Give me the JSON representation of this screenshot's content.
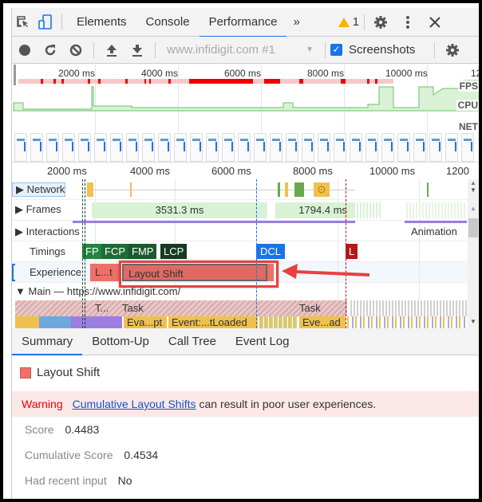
{
  "tabbar": {
    "tabs": [
      {
        "label": "Elements",
        "active": false
      },
      {
        "label": "Console",
        "active": false
      },
      {
        "label": "Performance",
        "active": true
      }
    ],
    "more_tabs": "»",
    "warning_count": "1"
  },
  "toolbar": {
    "recording_select": "www.infidigit.com #1",
    "screenshots_label": "Screenshots",
    "screenshots_checked": true
  },
  "overview": {
    "ticks": [
      "2000 ms",
      "4000 ms",
      "6000 ms",
      "8000 ms",
      "10000 ms",
      "12"
    ],
    "tracks": [
      "FPS",
      "CPU",
      "NET"
    ]
  },
  "timeline": {
    "ticks": [
      "2000 ms",
      "4000 ms",
      "6000 ms",
      "8000 ms",
      "10000 ms",
      "1200"
    ],
    "rows": {
      "network": "Network",
      "frames": "Frames",
      "frames_overlay": "s",
      "interactions": "Interactions",
      "interactions_overlay": "nation",
      "timings": "Timings",
      "experience": "Experience",
      "main": "Main — https://www.infidigit.com/"
    },
    "frames_durations": [
      "3531.3 ms",
      "1794.4 ms"
    ],
    "animation_label": "Animation",
    "timing_markers": [
      "FP",
      "FCP",
      "FMP",
      "LCP",
      "DCL",
      "L"
    ],
    "experience_bars": [
      "L...t",
      "Layout Shift"
    ],
    "main_tasks": [
      "T...",
      "Task",
      "Task"
    ],
    "sub_tasks": [
      "Eva...pt",
      "Event:...tLoaded",
      "Eve...ad"
    ]
  },
  "bottom_tabs": [
    {
      "label": "Summary",
      "active": true
    },
    {
      "label": "Bottom-Up",
      "active": false
    },
    {
      "label": "Call Tree",
      "active": false
    },
    {
      "label": "Event Log",
      "active": false
    }
  ],
  "summary": {
    "title": "Layout Shift",
    "swatch_color": "#f07167",
    "warning_label": "Warning",
    "warning_link": "Cumulative Layout Shifts",
    "warning_text": "can result in poor user experiences.",
    "fields": [
      {
        "key": "Score",
        "value": "0.4483"
      },
      {
        "key": "Cumulative Score",
        "value": "0.4534"
      },
      {
        "key": "Had recent input",
        "value": "No"
      }
    ]
  }
}
